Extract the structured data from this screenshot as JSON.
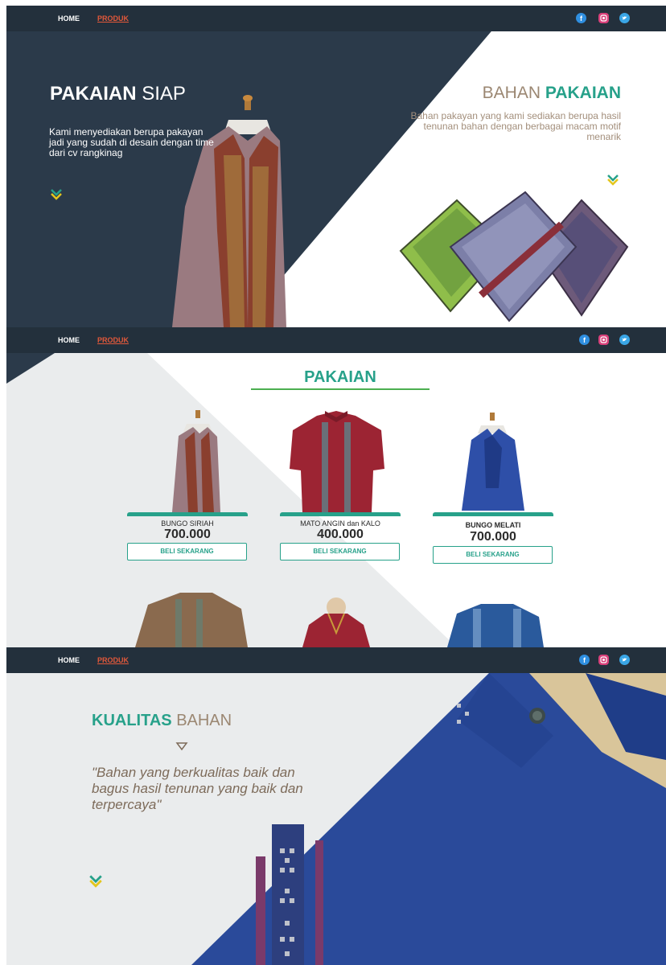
{
  "nav": {
    "home_label": "HOME",
    "produk_label": "PRODUK",
    "social_icons": [
      "facebook-icon",
      "instagram-icon",
      "twitter-icon"
    ]
  },
  "hero": {
    "left_title_bold": "PAKAIAN",
    "left_title_light": "SIAP",
    "left_desc": "Kami menyediakan berupa pakayan jadi yang sudah di desain dengan time dari cv rangkinag",
    "right_title_light": "BAHAN",
    "right_title_bold": "PAKAIAN",
    "right_desc": "Bahan pakayan yang kami sediakan berupa hasil tenunan bahan dengan berbagai macam motif menarik"
  },
  "products": {
    "title": "PAKAIAN",
    "items": [
      {
        "name": "BUNGO SIRIAH",
        "price": "700.000",
        "button": "BELI SEKARANG"
      },
      {
        "name": "MATO ANGIN dan KALO",
        "price": "400.000",
        "button": "BELI SEKARANG"
      },
      {
        "name": "BUNGO MELATI",
        "price": "700.000",
        "button": "BELI SEKARANG"
      }
    ]
  },
  "quality": {
    "title_bold": "KUALITAS",
    "title_light": "BAHAN",
    "quote": "\"Bahan yang berkualitas baik dan bagus hasil tenunan yang baik dan terpercaya\""
  },
  "colors": {
    "nav_bg": "#23303c",
    "dark_panel": "#2b3a4a",
    "accent_teal": "#27a18a",
    "accent_orange": "#e2583a",
    "tan_text": "#9b8772"
  }
}
